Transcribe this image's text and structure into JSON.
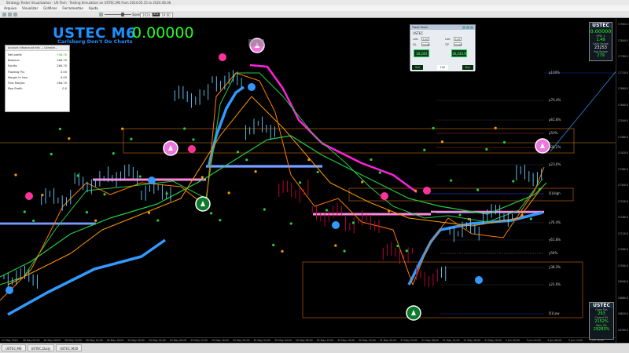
{
  "window": {
    "title": "Strategy Tester Visualization - US Tech · Testing Simulation on USTEC,M6 from 2024.05.15 to 2024.06.06"
  },
  "menu": [
    "Arquivo",
    "Visualizar",
    "Gráficos",
    "Ferramentas",
    "Ajuda"
  ],
  "toolbar": {
    "speed_label": "Speed",
    "date_text": "2024.05.30 19:00",
    "speed_value": "32x"
  },
  "chart": {
    "symbol_title": "USTEC M6",
    "symbol_subtitle": "Carlsberg Don't Do Charts",
    "profit_big": "0.00000",
    "level_labels": [
      "p100%",
      "p76.4%",
      "p61.8%",
      "p50%",
      "p38.2%",
      "p23.6%",
      "D1High",
      "y76.4%",
      "y61.8%",
      "y50%",
      "y38.2%",
      "y23.6%",
      "D1Low",
      "y0.0%"
    ],
    "price_ticks": [
      "17900.0",
      "17840.0",
      "17780.0",
      "17720.0",
      "17660.0",
      "17600.0",
      "17540.0",
      "17480.0",
      "17420.0",
      "17360.0",
      "17300.0",
      "17240.0",
      "17180.0",
      "17120.0",
      "17060.0",
      "17000.0",
      "16940.0",
      "16880.0",
      "16820.0",
      "16760.0"
    ],
    "time_ticks": [
      "27 May 2024",
      "28 May 02:00",
      "28 May 06:00",
      "28 May 10:00",
      "28 May 14:00",
      "28 May 18:00",
      "29 May 00:00",
      "29 May 04:00",
      "29 May 08:00",
      "29 May 12:00",
      "29 May 16:00",
      "29 May 20:00",
      "30 May 00:00",
      "30 May 04:00",
      "30 May 08:00",
      "30 May 12:00",
      "30 May 16:00",
      "30 May 20:00",
      "31 May 00:00",
      "31 May 04:00",
      "31 May 08:00",
      "31 May 12:00",
      "31 May 16:00",
      "31 May 20:00",
      "3 Jun 00:00",
      "3 Jun 04:00",
      "3 Jun 08:00",
      "3 Jun 12:00",
      "3 Jun 16:00"
    ]
  },
  "account_panel": {
    "title": "Account Infoanount Info — Carsstle...",
    "rows": [
      {
        "label": "Net profit:",
        "value": "+54.70"
      },
      {
        "label": "Balance:",
        "value": "264.70"
      },
      {
        "label": "Equity:",
        "value": "264.70"
      },
      {
        "label": "Floating P/L:",
        "value": "0.00"
      },
      {
        "label": "Margin In Use:",
        "value": "0.00"
      },
      {
        "label": "Free Margin:",
        "value": "264.70"
      },
      {
        "label": "Pips Profit:",
        "value": "0.0"
      }
    ]
  },
  "trade_panel": {
    "title": "Trade Panel",
    "symbol": "USTEC",
    "lot_label": "Lots",
    "lot_value": "0.10",
    "sl_label": "S/L",
    "sl_value": "20000",
    "tp_label": "T/P",
    "tp_value": "20000",
    "sell_price": "18,240",
    "buy_price": "18,244.90",
    "sell_label": "Sell",
    "buy_label": "Buy",
    "spread": "100"
  },
  "widget_top": {
    "title": "USTEC",
    "big": "0.00000",
    "spread_label": "SPD: 1",
    "ratio": "1.49",
    "line1": "Daily Range",
    "val1": "23253",
    "line2": "Avg Range",
    "val2": "279"
  },
  "widget_bottom": {
    "title": "USTEC",
    "l1": "Open Pos",
    "v1": "293",
    "l2": "Closed P/L",
    "v2": "2152%",
    "l3": "Daily P/L",
    "v3": "29283%"
  },
  "tabs": [
    "USTEC,M6",
    "USTEC,Daily",
    "USTEC,M30"
  ],
  "colors": {
    "ema_green": "#22cc44",
    "ema_orange": "#ff9900",
    "ema_magenta": "#ff22dd",
    "ema_blue": "#3399ff",
    "candles": "#cc0044",
    "sky_candles": "#66ccff"
  }
}
